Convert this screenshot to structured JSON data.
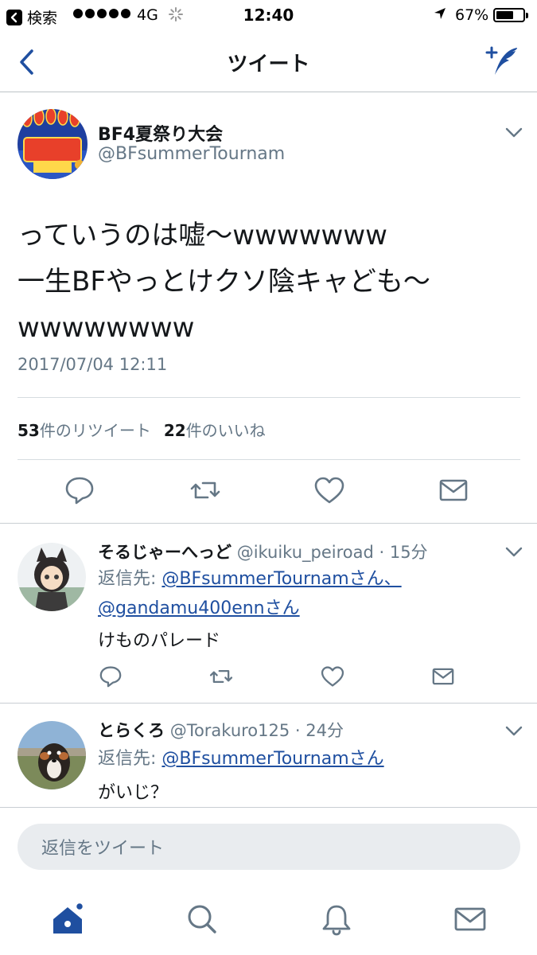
{
  "status_bar": {
    "back_app_label": "検索",
    "network": "4G",
    "time": "12:40",
    "battery_percent_label": "67%",
    "battery_level": 0.67
  },
  "nav": {
    "title": "ツイート"
  },
  "tweet": {
    "author_name": "BF4夏祭り大会",
    "author_handle": "@BFsummerTournam",
    "body_line1": "っていうのは嘘〜wwwwwww",
    "body_line2": "一生BFやっとけクソ陰キャども〜",
    "body_line3": "wwwwwwww",
    "timestamp": "2017/07/04 12:11",
    "retweet_count": "53",
    "retweet_label": "件のリツイート",
    "like_count": "22",
    "like_label": "件のいいね"
  },
  "replies": [
    {
      "name": "そるじゃーへっど",
      "handle_time": "@ikuiku_peiroad · 15分",
      "reply_prefix": "返信先:",
      "mention1": "@BFsummerTournamさん、",
      "mention2": "@gandamu400ennさん",
      "text": "けものパレード"
    },
    {
      "name": "とらくろ",
      "handle_time": "@Torakuro125 · 24分",
      "reply_prefix": "返信先:",
      "mention1": "@BFsummerTournamさん",
      "text": "がいじ？"
    }
  ],
  "reply_box": {
    "placeholder": "返信をツイート"
  },
  "colors": {
    "accent": "#1f4fa0",
    "secondary_text": "#657786",
    "divider": "#d6dce0"
  },
  "icons": {
    "nav_back": "chevron-left-icon",
    "compose": "compose-tweet-icon",
    "reply": "reply-icon",
    "retweet": "retweet-icon",
    "like": "heart-icon",
    "dm": "envelope-icon",
    "home": "home-icon",
    "search": "search-icon",
    "notifications": "bell-icon",
    "messages": "envelope-icon"
  }
}
